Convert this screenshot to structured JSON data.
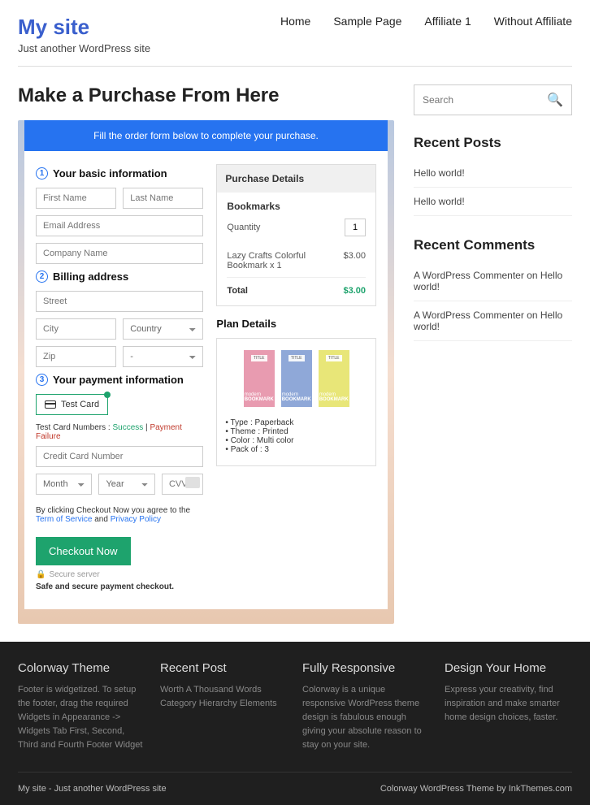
{
  "site": {
    "title": "My site",
    "tagline": "Just another WordPress site"
  },
  "nav": [
    {
      "label": "Home"
    },
    {
      "label": "Sample Page"
    },
    {
      "label": "Affiliate 1"
    },
    {
      "label": "Without Affiliate"
    }
  ],
  "page": {
    "title": "Make a Purchase From Here"
  },
  "banner": "Fill the order form below to complete your purchase.",
  "form": {
    "s1": "Your basic information",
    "s2": "Billing address",
    "s3": "Your payment information",
    "first": "First Name",
    "last": "Last Name",
    "email": "Email Address",
    "company": "Company Name",
    "street": "Street",
    "city": "City",
    "country": "Country",
    "zip": "Zip",
    "dash": "-",
    "test_card": "Test Card",
    "test_note_pre": "Test Card Numbers : ",
    "success": "Success",
    "sep": " | ",
    "failure": "Payment Failure",
    "ccnum": "Credit Card Number",
    "month": "Month",
    "year": "Year",
    "cvv": "CVV",
    "terms_pre": "By clicking Checkout Now you agree to the ",
    "tos": "Term of Service",
    "and": " and ",
    "pp": "Privacy Policy",
    "checkout": "Checkout Now",
    "secure": "Secure server",
    "safe": "Safe and secure payment checkout."
  },
  "details": {
    "hd": "Purchase Details",
    "product": "Bookmarks",
    "qty_label": "Quantity",
    "qty": "1",
    "item_name": "Lazy Crafts Colorful Bookmark x 1",
    "item_price": "$3.00",
    "total_label": "Total",
    "total": "$3.00"
  },
  "plan": {
    "hd": "Plan Details",
    "book_title": "TITLE",
    "book_brand": "modern",
    "book_sub": "BOOKMARK",
    "bullets": [
      "Type : Paperback",
      "Theme : Printed",
      "Color : Multi color",
      "Pack of : 3"
    ]
  },
  "sidebar": {
    "search": "Search",
    "posts_hd": "Recent Posts",
    "posts": [
      "Hello world!",
      "Hello world!"
    ],
    "comments_hd": "Recent Comments",
    "comments": [
      {
        "author": "A WordPress Commenter",
        "on": " on ",
        "post": "Hello world!"
      },
      {
        "author": "A WordPress Commenter",
        "on": " on ",
        "post": "Hello world!"
      }
    ]
  },
  "footer": {
    "cols": [
      {
        "hd": "Colorway Theme",
        "txt": "Footer is widgetized. To setup the footer, drag the required Widgets in Appearance -> Widgets Tab First, Second, Third and Fourth Footer Widget"
      },
      {
        "hd": "Recent Post",
        "txt": "Worth A Thousand Words Category Hierarchy Elements"
      },
      {
        "hd": "Fully Responsive",
        "txt": "Colorway is a unique responsive WordPress theme design is fabulous enough giving your absolute reason to stay on your site."
      },
      {
        "hd": "Design Your Home",
        "txt": "Express your creativity, find inspiration and make smarter home design choices, faster."
      }
    ],
    "bl": "My site - Just another WordPress site",
    "br": "Colorway WordPress Theme by InkThemes.com"
  }
}
